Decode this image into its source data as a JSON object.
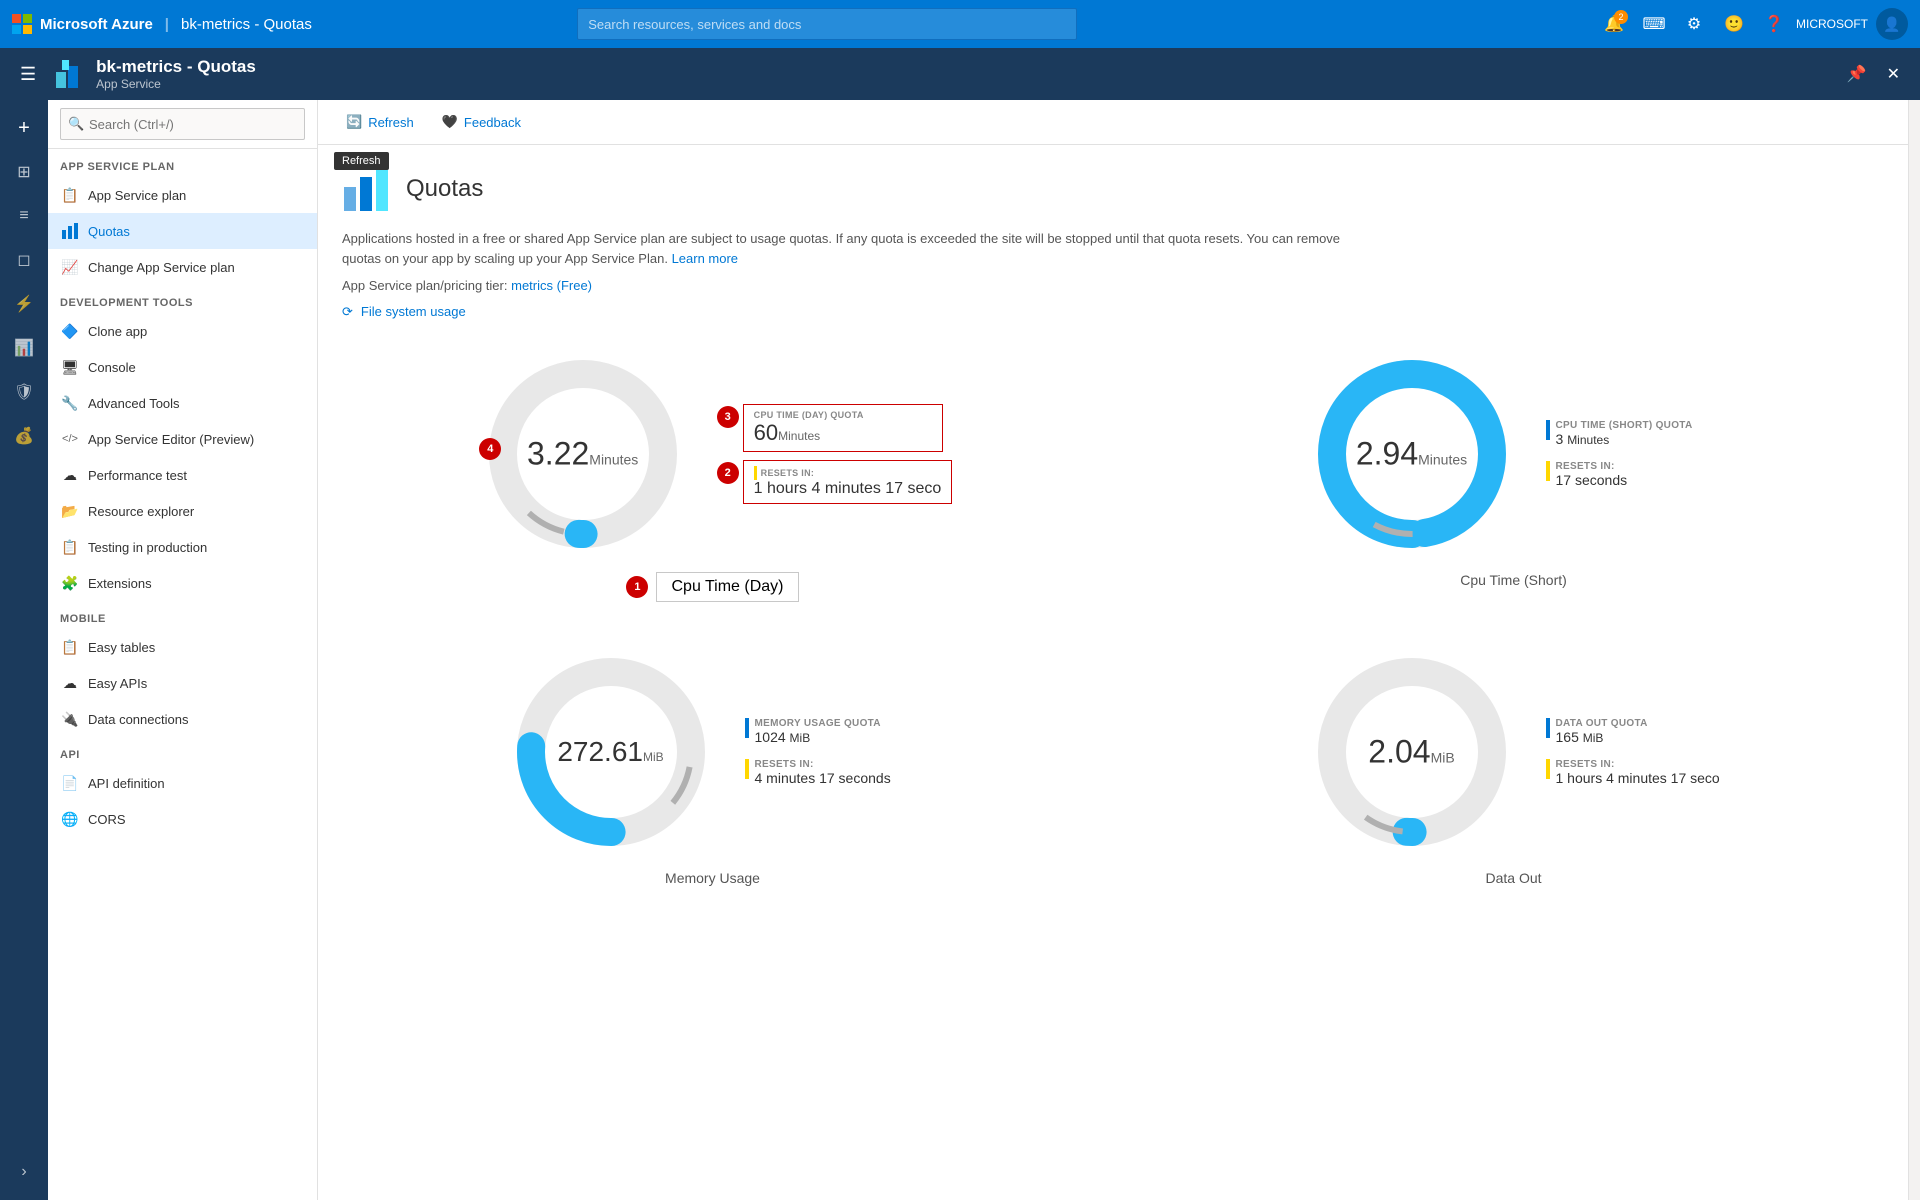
{
  "topnav": {
    "brand": "Microsoft Azure",
    "resource_path": "bk-metrics - Quotas",
    "search_placeholder": "Search resources, services and docs",
    "notification_count": "2",
    "user_name": "MICROSOFT"
  },
  "secondbar": {
    "app_name": "bk-metrics - Quotas",
    "app_type": "App Service"
  },
  "sidebar": {
    "search_placeholder": "Search (Ctrl+/)",
    "sections": [
      {
        "header": "APP SERVICE PLAN",
        "items": [
          {
            "label": "App Service plan",
            "icon": "📋",
            "active": false
          },
          {
            "label": "Quotas",
            "icon": "📊",
            "active": true
          },
          {
            "label": "Change App Service plan",
            "icon": "📈",
            "active": false
          }
        ]
      },
      {
        "header": "DEVELOPMENT TOOLS",
        "items": [
          {
            "label": "Clone app",
            "icon": "🔷",
            "active": false
          },
          {
            "label": "Console",
            "icon": "🖥",
            "active": false
          },
          {
            "label": "Advanced Tools",
            "icon": "🔧",
            "active": false
          },
          {
            "label": "App Service Editor (Preview)",
            "icon": "</>",
            "active": false
          },
          {
            "label": "Performance test",
            "icon": "☁",
            "active": false
          },
          {
            "label": "Resource explorer",
            "icon": "📂",
            "active": false
          },
          {
            "label": "Testing in production",
            "icon": "📋",
            "active": false
          },
          {
            "label": "Extensions",
            "icon": "🧩",
            "active": false
          }
        ]
      },
      {
        "header": "MOBILE",
        "items": [
          {
            "label": "Easy tables",
            "icon": "📋",
            "active": false
          },
          {
            "label": "Easy APIs",
            "icon": "☁",
            "active": false
          },
          {
            "label": "Data connections",
            "icon": "🔌",
            "active": false
          }
        ]
      },
      {
        "header": "API",
        "items": [
          {
            "label": "API definition",
            "icon": "📄",
            "active": false
          },
          {
            "label": "CORS",
            "icon": "🌐",
            "active": false
          }
        ]
      }
    ]
  },
  "toolbar": {
    "refresh_label": "Refresh",
    "feedback_label": "Feedback",
    "tooltip_text": "Refresh"
  },
  "page": {
    "title": "Quotas",
    "description": "Applications hosted in a free or shared App Service plan are subject to usage quotas. If any quota is exceeded the site will be stopped until that quota resets. You can remove quotas on your app by scaling up your App Service Plan.",
    "learn_more": "Learn more",
    "plan_info": "App Service plan/pricing tier:",
    "plan_link": "metrics (Free)",
    "file_system_label": "File system usage",
    "gauges": [
      {
        "id": "cpu-day",
        "label": "Cpu Time (Day)",
        "value": "3.22",
        "unit": "Minutes",
        "quota_label": "CPU TIME (DAY) QUOTA",
        "quota_value": "60",
        "quota_unit": "Minutes",
        "resets_label": "RESETS IN:",
        "resets_value": "1 hours 4 minutes 17 seco",
        "fill_percent": 5.4,
        "color": "#29b6f6",
        "callout_num_label": 1,
        "quota_num_label": 3,
        "resets_num_label": 2,
        "value_num_label": 4
      },
      {
        "id": "cpu-short",
        "label": "Cpu Time (Short)",
        "value": "2.94",
        "unit": "Minutes",
        "quota_label": "CPU TIME (SHORT) QUOTA",
        "quota_value": "3",
        "quota_unit": "Minutes",
        "resets_label": "RESETS IN:",
        "resets_value": "17 seconds",
        "fill_percent": 98,
        "color": "#29b6f6",
        "callout_num_label": null,
        "quota_num_label": null,
        "resets_num_label": null,
        "value_num_label": null
      },
      {
        "id": "memory",
        "label": "Memory Usage",
        "value": "272.61",
        "unit": "MiB",
        "quota_label": "MEMORY USAGE QUOTA",
        "quota_value": "1024",
        "quota_unit": "MiB",
        "resets_label": "RESETS IN:",
        "resets_value": "4 minutes 17 seconds",
        "fill_percent": 26.6,
        "color": "#29b6f6",
        "callout_num_label": null,
        "quota_num_label": null,
        "resets_num_label": null,
        "value_num_label": null
      },
      {
        "id": "data-out",
        "label": "Data Out",
        "value": "2.04",
        "unit": "MiB",
        "quota_label": "DATA OUT QUOTA",
        "quota_value": "165",
        "quota_unit": "MiB",
        "resets_label": "RESETS IN:",
        "resets_value": "1 hours 4 minutes 17 seco",
        "fill_percent": 1.2,
        "color": "#29b6f6",
        "callout_num_label": null,
        "quota_num_label": null,
        "resets_num_label": null,
        "value_num_label": null
      }
    ]
  }
}
